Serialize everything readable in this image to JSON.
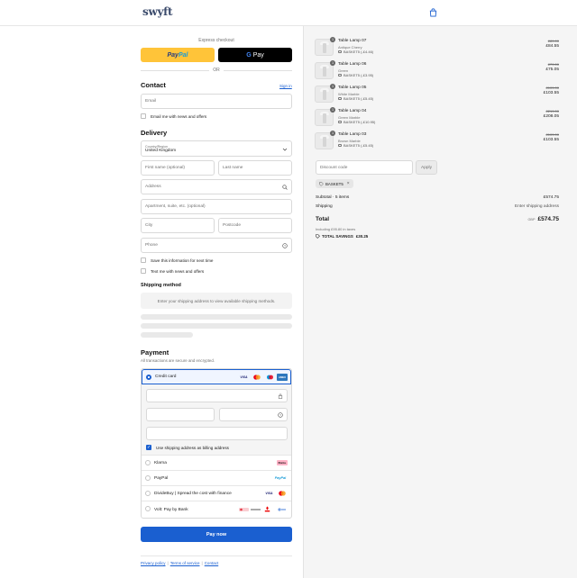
{
  "header": {
    "logo": "swyft",
    "cart_icon": "shopping-bag-icon"
  },
  "express": {
    "label": "Express checkout",
    "paypal_label_a": "Pay",
    "paypal_label_b": "Pal",
    "gpay_label_g": "G",
    "gpay_label": "Pay",
    "or_label": "OR"
  },
  "contact": {
    "heading": "Contact",
    "sign_in": "Sign in",
    "email_placeholder": "Email",
    "email_news": "Email me with news and offers"
  },
  "delivery": {
    "heading": "Delivery",
    "country_label": "Country/Region",
    "country_value": "United Kingdom",
    "first_name_placeholder": "First name (optional)",
    "last_name_placeholder": "Last name",
    "address_placeholder": "Address",
    "apartment_placeholder": "Apartment, suite, etc. (optional)",
    "city_placeholder": "City",
    "postcode_placeholder": "Postcode",
    "phone_placeholder": "Phone",
    "save_info": "Save this information for next time",
    "text_news": "Text me with news and offers"
  },
  "shipping": {
    "heading": "Shipping method",
    "note": "Enter your shipping address to view available shipping methods."
  },
  "payment": {
    "heading": "Payment",
    "subtitle": "All transactions are secure and encrypted.",
    "credit_card": "Credit card",
    "billing_same": "Use shipping address as billing address",
    "options": [
      {
        "label": "Klarna",
        "logo": "Klarna."
      },
      {
        "label": "PayPal",
        "logo": "PayPal"
      },
      {
        "label": "DivideBuy | Spread the cost with finance",
        "logo": "VISA"
      },
      {
        "label": "Volt: Pay by Bank",
        "logo": "bank"
      }
    ],
    "card_logos": [
      "VISA",
      "MC",
      "AMEX"
    ],
    "pay_now": "Pay now"
  },
  "footer": {
    "links": [
      "Privacy policy",
      "Terms of service",
      "Contact"
    ]
  },
  "cart": {
    "items": [
      {
        "name": "Table Lamp 07",
        "variant": "Antique Cherry",
        "discount": "BASKET5 (-£4.46)",
        "compare": "£89.00",
        "price": "£84.55",
        "qty": "1"
      },
      {
        "name": "Table Lamp 06",
        "variant": "Green",
        "discount": "BASKET5 (-£3.95)",
        "compare": "£79.00",
        "price": "£75.05",
        "qty": "1"
      },
      {
        "name": "Table Lamp 05",
        "variant": "White Marble",
        "discount": "BASKET5 (-£5.45)",
        "compare": "£109.00",
        "price": "£103.55",
        "qty": "1"
      },
      {
        "name": "Table Lamp 04",
        "variant": "Green Marble",
        "discount": "BASKET5 (-£10.95)",
        "compare": "£219.00",
        "price": "£208.05",
        "qty": "1"
      },
      {
        "name": "Table Lamp 03",
        "variant": "Brown Marble",
        "discount": "BASKET5 (-£5.45)",
        "compare": "£109.00",
        "price": "£103.55",
        "qty": "1"
      }
    ],
    "discount_placeholder": "Discount code",
    "apply": "Apply",
    "applied_code": "BASKET5",
    "subtotal_label": "Subtotal · 5 items",
    "subtotal_value": "£574.75",
    "shipping_label": "Shipping",
    "shipping_value": "Enter shipping address",
    "total_label": "Total",
    "currency": "GBP",
    "total_value": "£574.75",
    "taxes": "Including £95.80 in taxes",
    "savings_label": "TOTAL SAVINGS",
    "savings_value": "£30.25"
  },
  "colors": {
    "accent": "#1a5fd0",
    "paypal": "#ffc439",
    "sidebar_bg": "#f5f5f5"
  }
}
